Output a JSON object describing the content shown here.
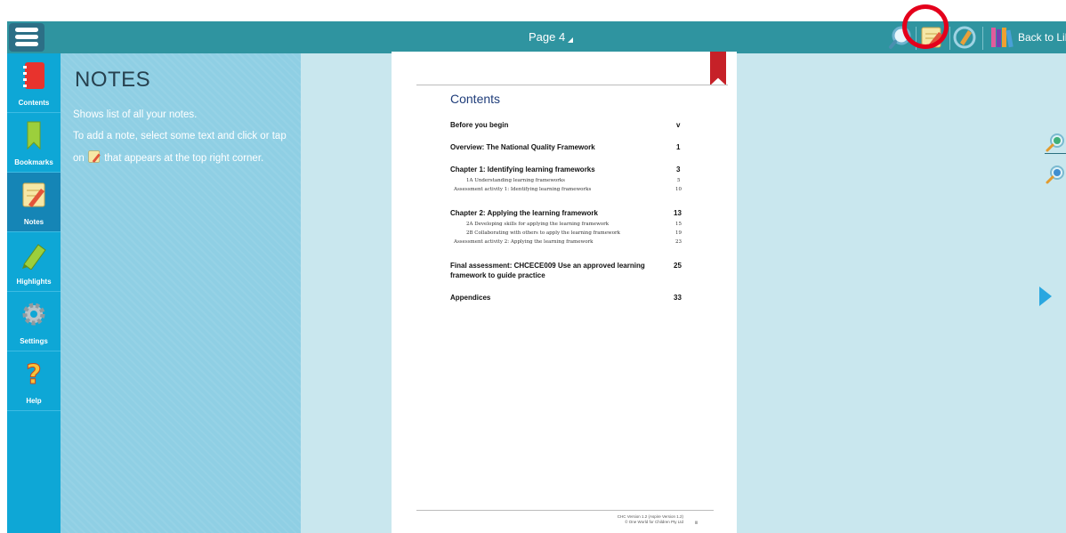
{
  "toolbar": {
    "page_label": "Page 4",
    "back_label": "Back to Library",
    "highlight_color": "#e4001b",
    "bar_color": "#2f94a0",
    "icons": [
      "search-icon",
      "add-note-icon",
      "highlight-tool-icon",
      "library-books-icon"
    ]
  },
  "sidebar": {
    "items": [
      {
        "label": "Contents",
        "icon": "contents-book-icon"
      },
      {
        "label": "Bookmarks",
        "icon": "bookmark-icon"
      },
      {
        "label": "Notes",
        "icon": "notes-pencil-icon",
        "active": true
      },
      {
        "label": "Highlights",
        "icon": "highlighter-icon"
      },
      {
        "label": "Settings",
        "icon": "gear-icon"
      },
      {
        "label": "Help",
        "icon": "question-icon"
      }
    ]
  },
  "notes_panel": {
    "title": "NOTES",
    "line1": "Shows list of all your notes.",
    "line2": "To add a note, select some text and click or tap",
    "line3_pre": "on",
    "line3_post": "that appears at the top right corner."
  },
  "document": {
    "title": "Contents",
    "entries": [
      {
        "text": "Before you begin",
        "page": "v",
        "level": "main"
      },
      {
        "text": "Overview: The National Quality Framework",
        "page": "1",
        "level": "main"
      },
      {
        "text": "Chapter 1: Identifying learning frameworks",
        "page": "3",
        "level": "main"
      },
      {
        "text": "1A  Understanding learning frameworks",
        "page": "5",
        "level": "sub"
      },
      {
        "text": "Assessment activity 1: Identifying learning frameworks",
        "page": "10",
        "level": "sub"
      },
      {
        "text": "Chapter 2: Applying the learning framework",
        "page": "13",
        "level": "main"
      },
      {
        "text": "2A  Developing skills for applying the learning framework",
        "page": "15",
        "level": "sub"
      },
      {
        "text": "2B  Collaborating with others to apply the learning framework",
        "page": "19",
        "level": "sub"
      },
      {
        "text": "Assessment activity 2: Applying the learning framework",
        "page": "23",
        "level": "sub"
      },
      {
        "text": "Final assessment: CHCECE009 Use an approved learning",
        "page": "25",
        "level": "main"
      },
      {
        "text": "framework to guide practice",
        "page": "",
        "level": "main"
      },
      {
        "text": "Appendices",
        "page": "33",
        "level": "main"
      }
    ],
    "footer_line1": "CHC Version 1.2 (Aspire Version 1.2)",
    "footer_line2": "© One World for Children Pty Ltd",
    "footer_page": "iii"
  }
}
